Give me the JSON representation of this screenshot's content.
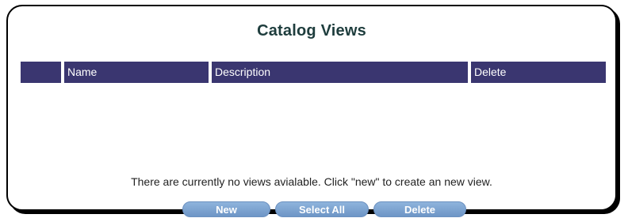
{
  "panel": {
    "title": "Catalog Views"
  },
  "table": {
    "columns": [
      "",
      "Name",
      "Description",
      "Delete"
    ]
  },
  "empty_message": "There are currently no views avialable. Click \"new\" to create an new view.",
  "buttons": {
    "new_label": "New",
    "select_all_label": "Select All",
    "delete_label": "Delete"
  },
  "colors": {
    "header_bg": "#3a3670",
    "button_bg": "#7ea5d3",
    "title_color": "#1e3d3d"
  }
}
